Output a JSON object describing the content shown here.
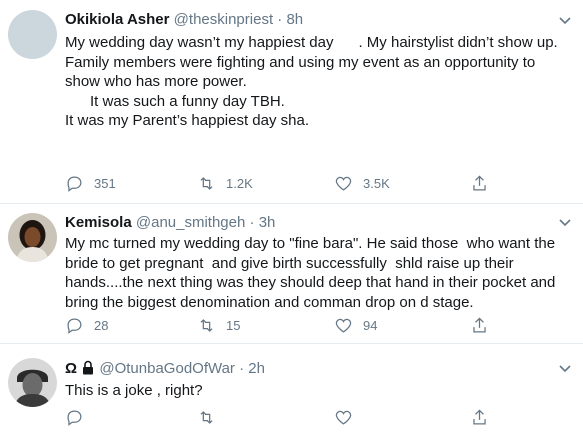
{
  "tweets": [
    {
      "name": "Okikiola Asher",
      "handle": "@theskinpriest",
      "dot": "·",
      "time": "8h",
      "lines": [
        "My wedding day wasn’t my happiest day      . My hairstylist didn’t show up.",
        "",
        "Family members were fighting and using my event as an opportunity to",
        "show who has more power.",
        "      It was such a funny day TBH.",
        "",
        "It was my Parent’s happiest day sha."
      ],
      "replies": "351",
      "retweets": "1.2K",
      "likes": "3.5K"
    },
    {
      "name": "Kemisola",
      "handle": "@anu_smithgeh",
      "dot": "·",
      "time": "3h",
      "lines": [
        "My mc turned my wedding day to \"fine bara\". He said those  who want the",
        "bride to get pregnant  and give birth successfully  shld raise up their",
        "hands....the next thing was they should deep that hand in their pocket and",
        "bring the biggest denomination and comman drop on d stage."
      ],
      "replies": "28",
      "retweets": "15",
      "likes": "94"
    },
    {
      "name": "Ω",
      "handle": "@OtunbaGodOfWar",
      "dot": "·",
      "time": "2h",
      "lines": [
        "This is a joke , right?"
      ],
      "replies": "",
      "retweets": "",
      "likes": ""
    }
  ],
  "icons": {
    "reply": "reply-icon",
    "retweet": "retweet-icon",
    "like": "like-icon",
    "share": "share-icon",
    "caret": "chevron-down-icon",
    "lock": "lock-icon"
  },
  "colors": {
    "text": "#14171a",
    "muted": "#657786",
    "divider": "#e6ecf0",
    "avatar_placeholder": "#ccd6dd"
  }
}
